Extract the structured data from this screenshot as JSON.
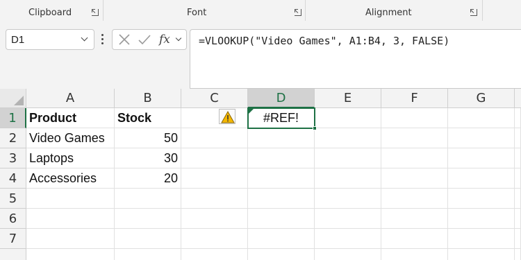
{
  "ribbon": {
    "groups": [
      {
        "label": "Clipboard"
      },
      {
        "label": "Font"
      },
      {
        "label": "Alignment"
      }
    ]
  },
  "formula_bar": {
    "name_box": "D1",
    "fx_label": "fx",
    "formula": "=VLOOKUP(\"Video Games\", A1:B4, 3, FALSE)"
  },
  "sheet": {
    "columns": [
      "A",
      "B",
      "C",
      "D",
      "E",
      "F",
      "G"
    ],
    "active_column": "D",
    "rows": [
      "1",
      "2",
      "3",
      "4",
      "5",
      "6",
      "7"
    ],
    "active_row": "1",
    "cells": {
      "A1": "Product",
      "B1": "Stock",
      "D1": "#REF!",
      "A2": "Video Games",
      "B2": "50",
      "A3": "Laptops",
      "B3": "30",
      "A4": "Accessories",
      "B4": "20"
    }
  },
  "colors": {
    "accent_green": "#1e7145",
    "warning_yellow": "#f5b800"
  },
  "icons": {
    "error_indicator": "warning-triangle-icon"
  }
}
